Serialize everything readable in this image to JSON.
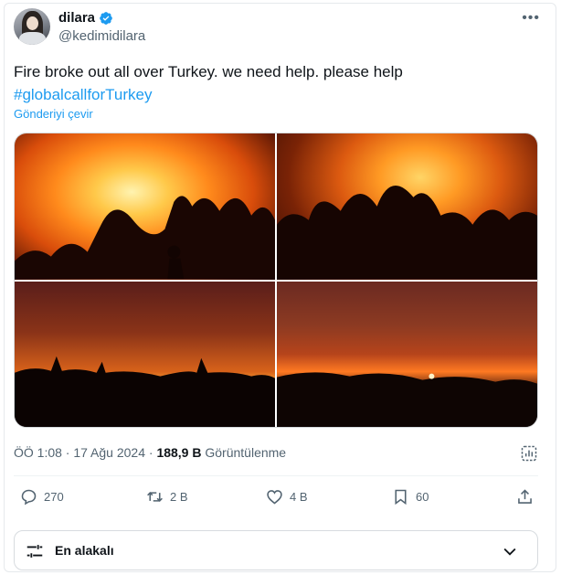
{
  "header": {
    "display_name": "dilara",
    "handle": "@kedimidilara",
    "more_label": "•••"
  },
  "tweet": {
    "text": "Fire broke out all over Turkey. we need help. please help",
    "hashtag": "#globalcallforTurkey",
    "translate_label": "Gönderiyi çevir"
  },
  "media": {
    "photos": [
      {
        "description_icon": "fire-photo-1"
      },
      {
        "description_icon": "fire-photo-2"
      },
      {
        "description_icon": "fire-photo-3"
      },
      {
        "description_icon": "fire-photo-4"
      }
    ]
  },
  "meta": {
    "time_date": "ÖÖ 1:08 · 17 Ağu 2024 · ",
    "views_count": "188,9 B",
    "views_label": " Görüntülenme"
  },
  "actions": {
    "replies": "270",
    "reposts": "2 B",
    "likes": "4 B",
    "bookmarks": "60"
  },
  "sort": {
    "label": "En alakalı"
  },
  "colors": {
    "accent": "#1d9bf0",
    "secondary_text": "#536471",
    "primary_text": "#0f1419"
  }
}
